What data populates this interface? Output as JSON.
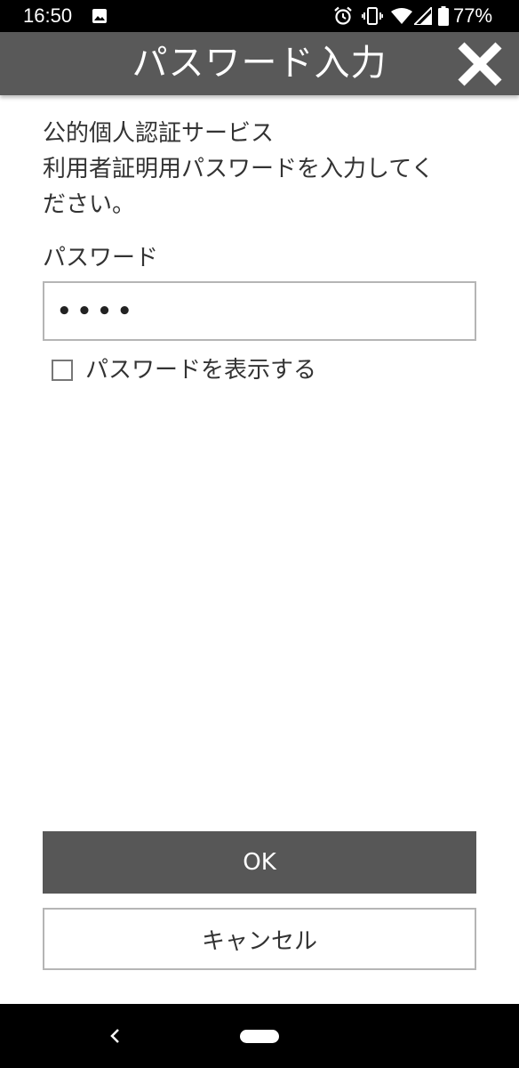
{
  "status_bar": {
    "time": "16:50",
    "battery": "77%"
  },
  "header": {
    "title": "パスワード入力"
  },
  "content": {
    "description_lines": [
      "公的個人認証サービス",
      "利用者証明用パスワードを入力してく",
      "ださい。"
    ],
    "password_label": "パスワード",
    "password_value": "••••",
    "show_password_label": "パスワードを表示する",
    "show_password_checked": false
  },
  "buttons": {
    "ok_label": "OK",
    "cancel_label": "キャンセル"
  },
  "icons": {
    "close": "close-icon",
    "back": "back-icon",
    "home": "home-pill-icon"
  },
  "colors": {
    "header_bg": "#595959",
    "ok_bg": "#575757",
    "border": "#b5b5b5"
  }
}
